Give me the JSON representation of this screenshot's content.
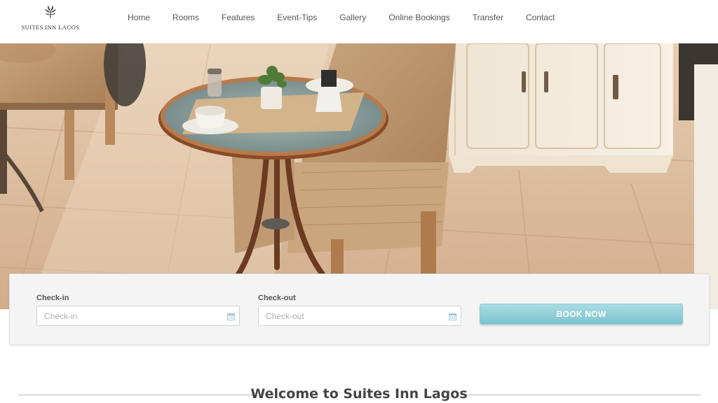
{
  "site": {
    "logo_text": "SUITES INN LAGOS",
    "logo_icon": "flower-icon"
  },
  "nav": {
    "items": [
      {
        "label": "Home"
      },
      {
        "label": "Rooms"
      },
      {
        "label": "Features"
      },
      {
        "label": "Event-Tips"
      },
      {
        "label": "Gallery"
      },
      {
        "label": "Online Bookings"
      },
      {
        "label": "Transfer"
      },
      {
        "label": "Contact"
      }
    ]
  },
  "booking": {
    "checkin_label": "Check-in",
    "checkin_placeholder": "Check-in",
    "checkout_label": "Check-out",
    "checkout_placeholder": "Check-out",
    "calendar_icon": "calendar-icon",
    "button_label": "BOOK NOW"
  },
  "welcome": {
    "title": "Welcome to Suites Inn Lagos"
  },
  "colors": {
    "button": "#8ccbd6",
    "nav_text": "#555555",
    "hero_floor": "#d9b99a"
  }
}
